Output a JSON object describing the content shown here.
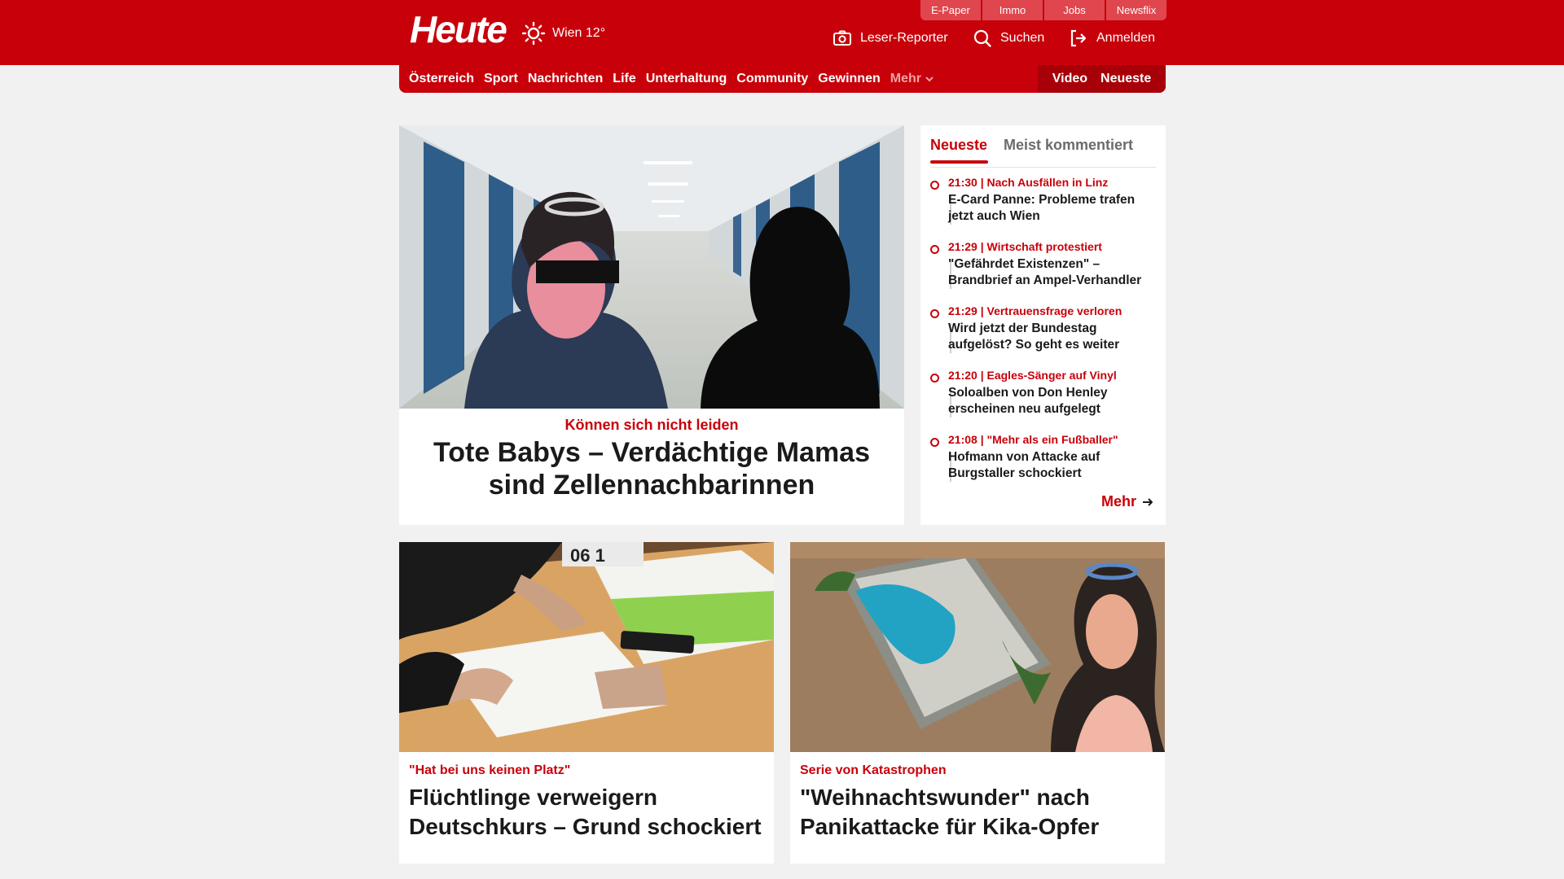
{
  "brand": {
    "logo": "Heute",
    "accent": "#c8000a"
  },
  "weather": {
    "label": "Wien 12°",
    "icon": "sun-icon"
  },
  "service_tabs": [
    "E-Paper",
    "Immo",
    "Jobs",
    "Newsflix"
  ],
  "header_actions": {
    "reporter": "Leser-Reporter",
    "search": "Suchen",
    "login": "Anmelden"
  },
  "nav": {
    "items": [
      "Österreich",
      "Sport",
      "Nachrichten",
      "Life",
      "Unterhaltung",
      "Community",
      "Gewinnen"
    ],
    "more": "Mehr",
    "video": "Video",
    "latest": "Neueste"
  },
  "hero": {
    "kicker": "Können sich nicht leiden",
    "title": "Tote Babys – Verdächtige Mamas sind Zellennachbarinnen"
  },
  "sidebar": {
    "tabs": [
      "Neueste",
      "Meist kommentiert"
    ],
    "items": [
      {
        "kicker": "21:30 | Nach Ausfällen in Linz",
        "title": "E-Card Panne: Probleme trafen jetzt auch Wien"
      },
      {
        "kicker": "21:29 | Wirtschaft protestiert",
        "title": "\"Gefährdet Existenzen\" – Brandbrief an Ampel-Verhandler"
      },
      {
        "kicker": "21:29 | Vertrauensfrage verloren",
        "title": "Wird jetzt der Bundestag aufgelöst? So geht es weiter"
      },
      {
        "kicker": "21:20 | Eagles-Sänger auf Vinyl",
        "title": "Soloalben von Don Henley erscheinen neu aufgelegt"
      },
      {
        "kicker": "21:08 | \"Mehr als ein Fußballer\"",
        "title": "Hofmann von Attacke auf Burgstaller schockiert"
      }
    ],
    "more": "Mehr"
  },
  "cards": [
    {
      "kicker": "\"Hat bei uns keinen Platz\"",
      "title": "Flüchtlinge verweigern Deutschkurs – Grund schockiert"
    },
    {
      "kicker": "Serie von Katastrophen",
      "title": "\"Weihnachtswunder\" nach Panikattacke für Kika-Opfer"
    }
  ]
}
